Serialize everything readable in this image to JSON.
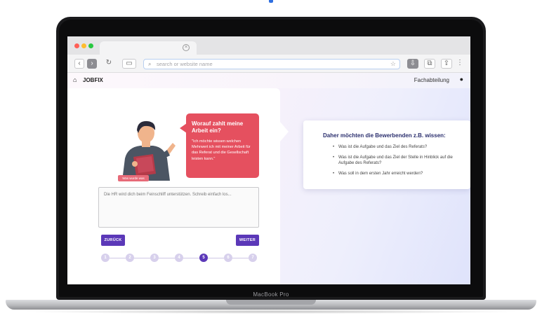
{
  "device": {
    "label": "MacBook Pro"
  },
  "browser": {
    "address_placeholder": "search or website name",
    "window_dots": [
      "#ff5f57",
      "#febc2e",
      "#28c840"
    ]
  },
  "app": {
    "brand": "JOBFIX",
    "department": "Fachabteilung"
  },
  "speech_bubble": {
    "title": "Worauf zahlt meine Arbeit ein?",
    "text": "\"Ich möchte wissen welchen Mehrwert ich mit meiner Arbeit für das Referat und die Gesellschaft leisten kann.\""
  },
  "illustration": {
    "caption": "Was wurde was"
  },
  "input": {
    "placeholder": "Die HR wird dich beim Feinschliff unterstützen. Schreib einfach los..."
  },
  "buttons": {
    "back": "ZURÜCK",
    "next": "WEITER"
  },
  "stepper": {
    "steps": [
      "1",
      "2",
      "3",
      "4",
      "5",
      "6",
      "7"
    ],
    "active_index": 4
  },
  "info_card": {
    "title": "Daher möchten die Bewerbenden z.B. wissen:",
    "items": [
      "Was ist die Aufgabe und das Ziel des Referats?",
      "Was ist die Aufgabe und das Ziel der Stelle in Hinblick auf die Aufgabe des Referats?",
      "Was soll in dem ersten Jahr erreicht werden?"
    ]
  },
  "colors": {
    "accent": "#5b38b8",
    "bubble": "#e5505f",
    "heading": "#2b2f6e"
  }
}
